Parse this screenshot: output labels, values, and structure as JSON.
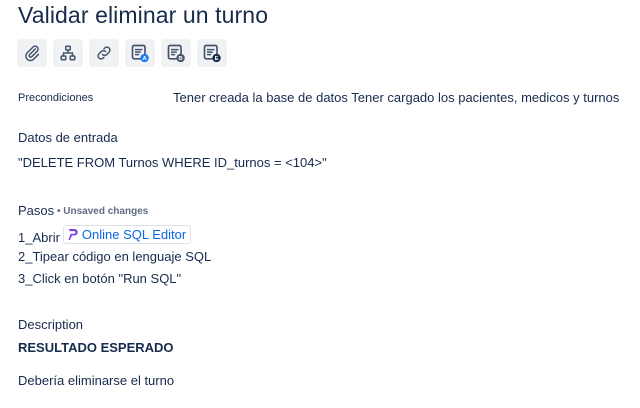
{
  "title": "Validar eliminar un turno",
  "toolbar": [
    {
      "icon": "attachment-icon"
    },
    {
      "icon": "hierarchy-icon"
    },
    {
      "icon": "link-icon"
    },
    {
      "icon": "editor-a-icon",
      "badge": "A"
    },
    {
      "icon": "editor-b-icon",
      "badge": "B"
    },
    {
      "icon": "editor-e-icon",
      "badge": "E"
    }
  ],
  "precondiciones": {
    "label": "Precondiciones",
    "value": "Tener creada la base de datos Tener cargado los pacientes, medicos y turnos"
  },
  "datos_entrada": {
    "label": "Datos de entrada",
    "value": "\"DELETE FROM Turnos WHERE ID_turnos = <104>\""
  },
  "pasos": {
    "label": "Pasos",
    "unsaved": "• Unsaved changes",
    "step1_prefix": "1_Abrir",
    "step1_link": "Online SQL Editor",
    "step2": "2_Tipear código en lenguaje SQL",
    "step3": "3_Click en botón \"Run SQL\""
  },
  "description": {
    "label": "Description",
    "subtitle": "RESULTADO ESPERADO",
    "text": "Debería eliminarse el turno"
  },
  "colors": {
    "text": "#172b4d",
    "link": "#0c66e4",
    "icon_bg": "#f1f2f4",
    "badge_blue": "#1d7afc"
  }
}
